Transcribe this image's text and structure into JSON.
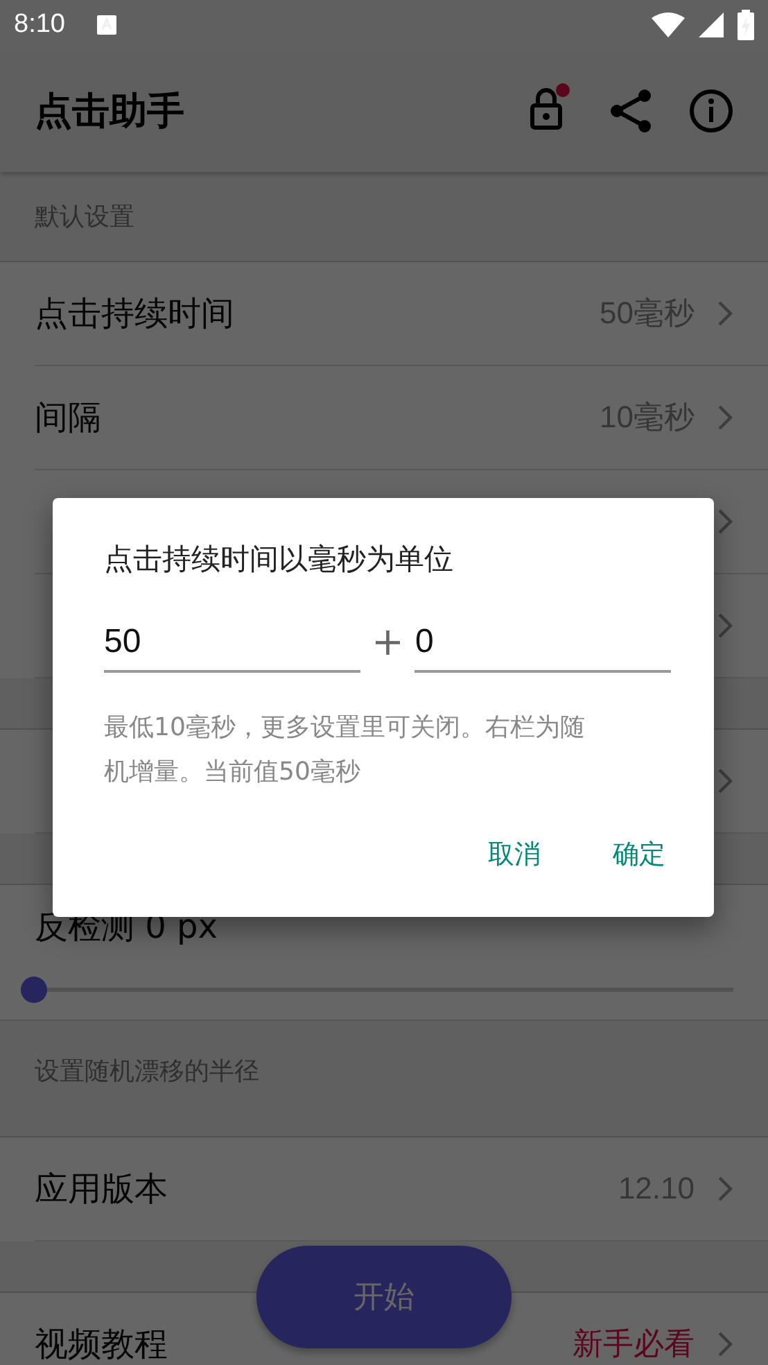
{
  "status_bar": {
    "time": "8:10"
  },
  "app_bar": {
    "title": "点击助手",
    "lock_badge": true
  },
  "groups": [
    {
      "header": "默认设置",
      "rows": [
        {
          "kind": "link",
          "label": "点击持续时间",
          "value": "50毫秒",
          "highlight": false
        },
        {
          "kind": "link",
          "label": "间隔",
          "value": "10毫秒",
          "highlight": false
        },
        {
          "kind": "link"
        },
        {
          "kind": "link"
        }
      ]
    },
    {
      "rows": [
        {
          "kind": "link"
        }
      ]
    },
    {
      "rows": [
        {
          "kind": "slider",
          "label": "反检测 0 px",
          "level": 0
        }
      ],
      "footer": "设置随机漂移的半径"
    },
    {
      "rows": [
        {
          "kind": "link",
          "label": "应用版本",
          "value": "12.10",
          "highlight": false
        }
      ]
    },
    {
      "rows": [
        {
          "kind": "link",
          "label": "视频教程",
          "value": "新手必看",
          "highlight": true
        }
      ]
    }
  ],
  "fab": {
    "label": "开始"
  },
  "dialog": {
    "title": "点击持续时间以毫秒为单位",
    "fields": [
      {
        "value": "50"
      },
      {
        "value": "0"
      }
    ],
    "separator": "+",
    "hint": "最低10毫秒，更多设置里可关闭。右栏为随机增量。当前值50毫秒",
    "buttons": [
      "取消",
      "确定"
    ]
  }
}
